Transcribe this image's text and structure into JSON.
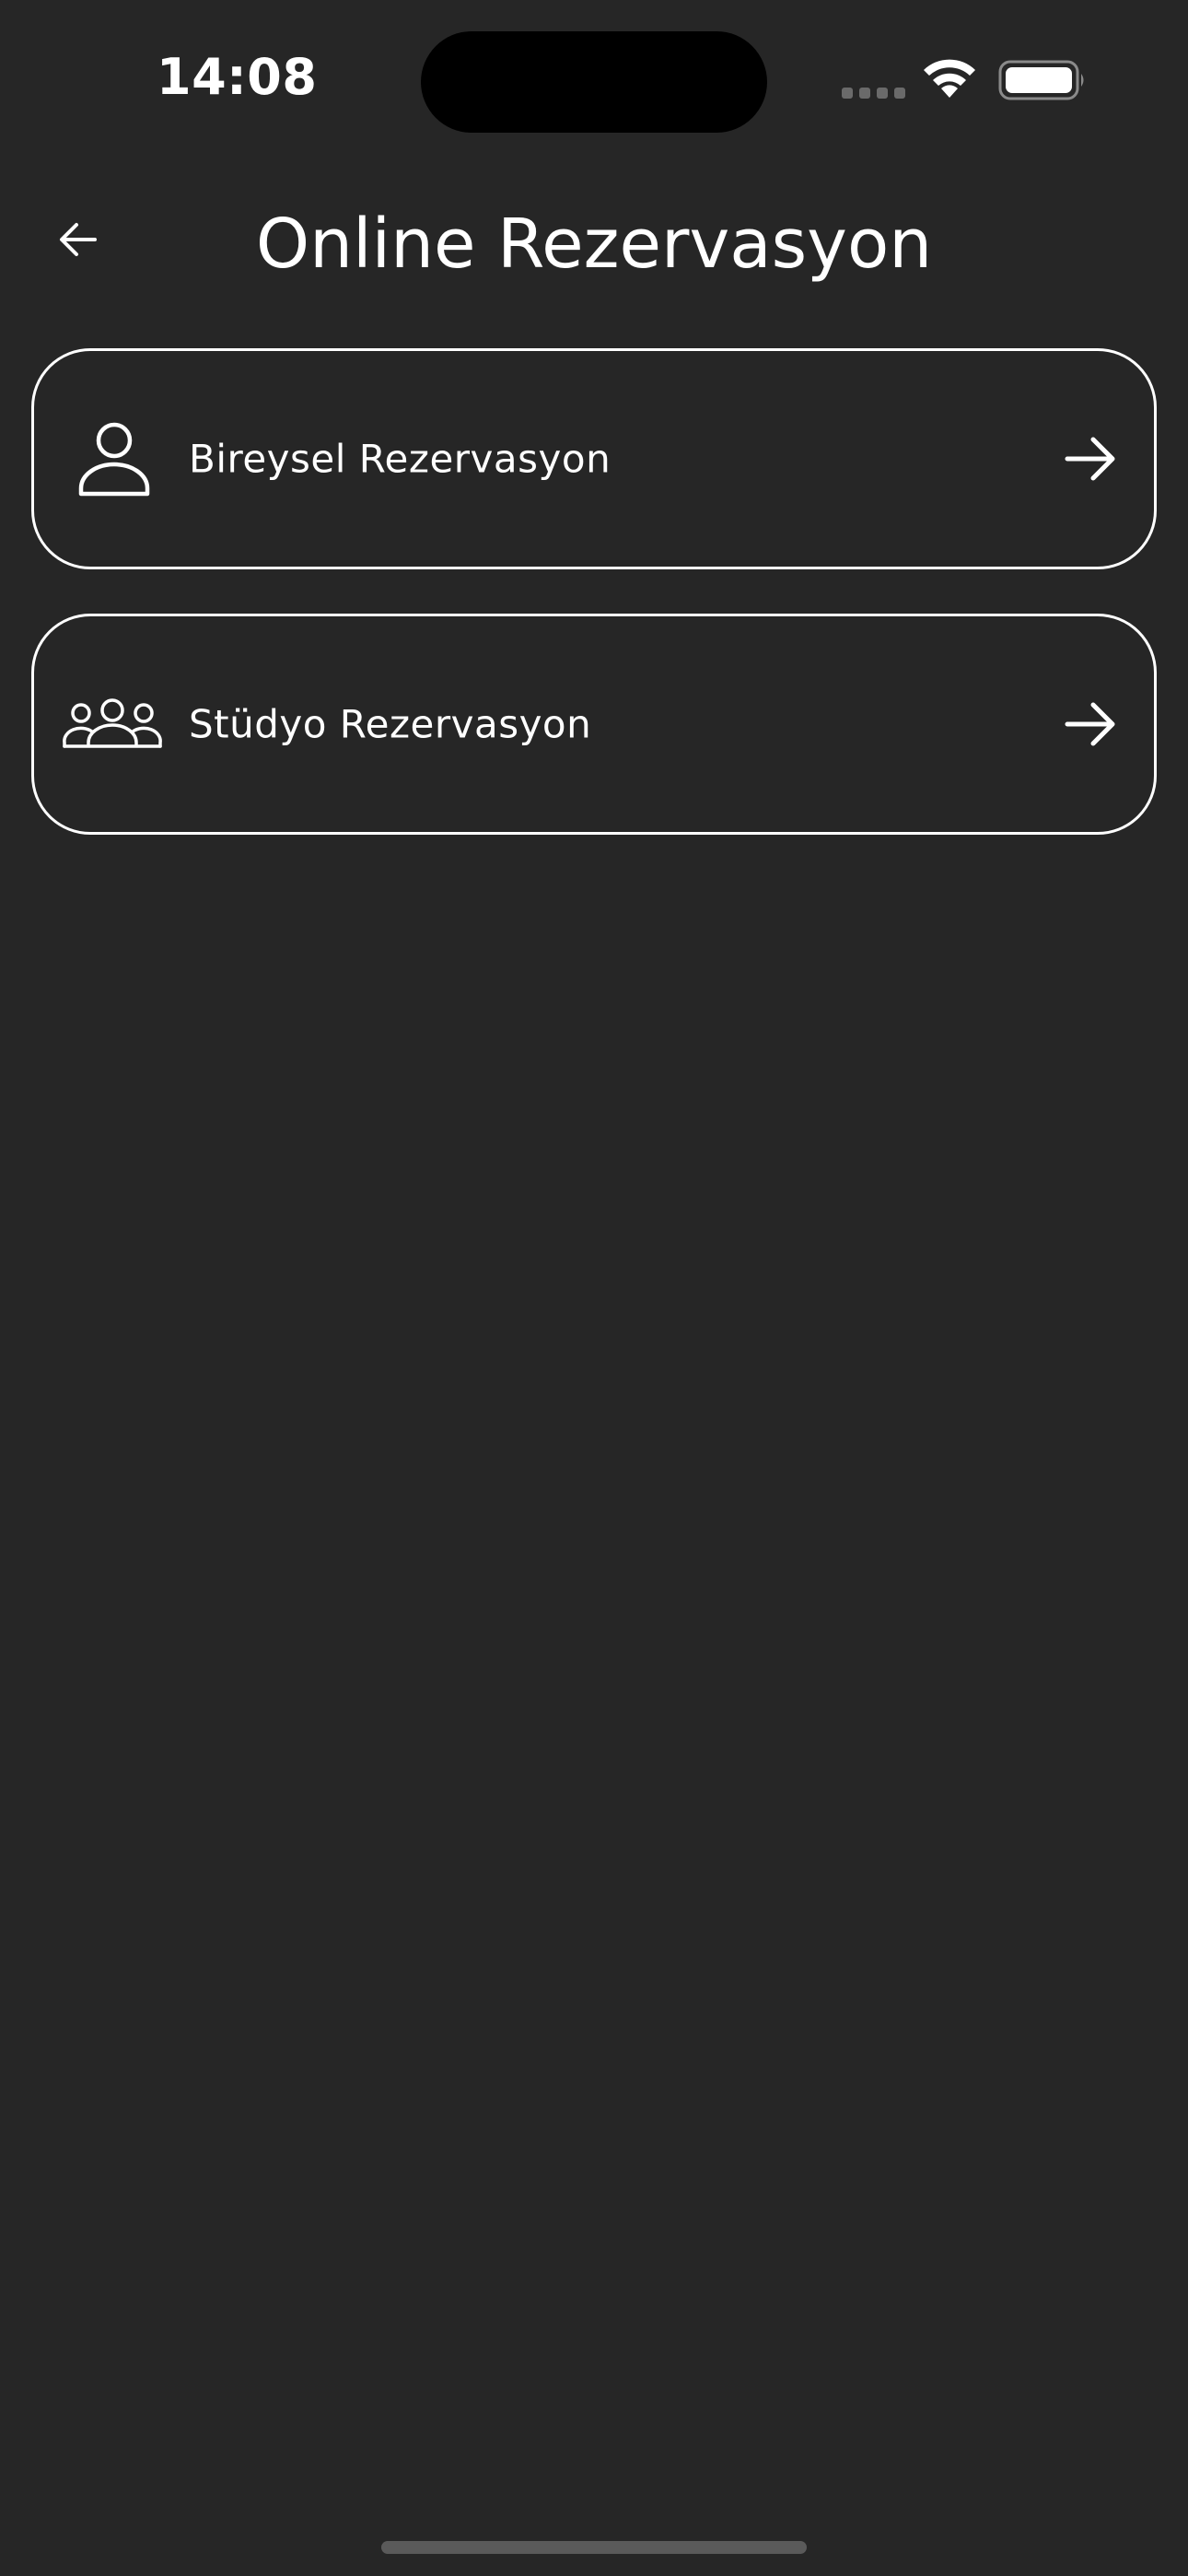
{
  "status_bar": {
    "time": "14:08",
    "icons": [
      "signal-dots-icon",
      "wifi-icon",
      "battery-icon"
    ]
  },
  "header": {
    "back_icon": "arrow-left-icon",
    "title": "Online Rezervasyon"
  },
  "menu": {
    "items": [
      {
        "label": "Bireysel Rezervasyon",
        "icon": "person-icon",
        "action_icon": "arrow-right-icon"
      },
      {
        "label": "Stüdyo Rezervasyon",
        "icon": "group-icon",
        "action_icon": "arrow-right-icon"
      }
    ]
  },
  "colors": {
    "background": "#262626",
    "foreground": "#ffffff",
    "island": "#000000",
    "home_indicator": "#5a5a5a"
  }
}
